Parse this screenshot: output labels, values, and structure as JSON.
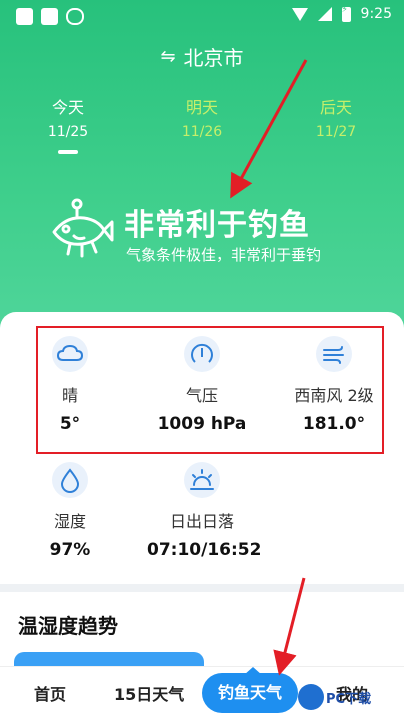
{
  "status_bar": {
    "time": "9:25"
  },
  "header": {
    "swap_icon": "⇋",
    "location": "北京市"
  },
  "days": [
    {
      "name": "今天",
      "date": "11/25"
    },
    {
      "name": "明天",
      "date": "11/26"
    },
    {
      "name": "后天",
      "date": "11/27"
    }
  ],
  "fishing": {
    "title": "非常利于钓鱼",
    "subtitle": "气象条件极佳，非常利于垂钓"
  },
  "metrics": [
    {
      "label": "晴",
      "value": "5°",
      "icon": "cloud-icon"
    },
    {
      "label": "气压",
      "value": "1009 hPa",
      "icon": "gauge-icon"
    },
    {
      "label": "西南风 2级",
      "value": "181.0°",
      "icon": "wind-icon"
    },
    {
      "label": "湿度",
      "value": "97%",
      "icon": "drop-icon"
    },
    {
      "label": "日出日落",
      "value": "07:10/16:52",
      "icon": "sunrise-icon"
    }
  ],
  "trend": {
    "title": "温湿度趋势"
  },
  "bottom_nav": {
    "home": "首页",
    "forecast": "15日天气",
    "fishing": "钓鱼天气",
    "mine": "我的"
  },
  "watermark": {
    "text": "PC下载"
  },
  "colors": {
    "primary_green": "#2bc47f",
    "accent_blue": "#1e8ff0",
    "highlight_red": "#e31e26",
    "inactive_day": "#c6ef6a"
  }
}
